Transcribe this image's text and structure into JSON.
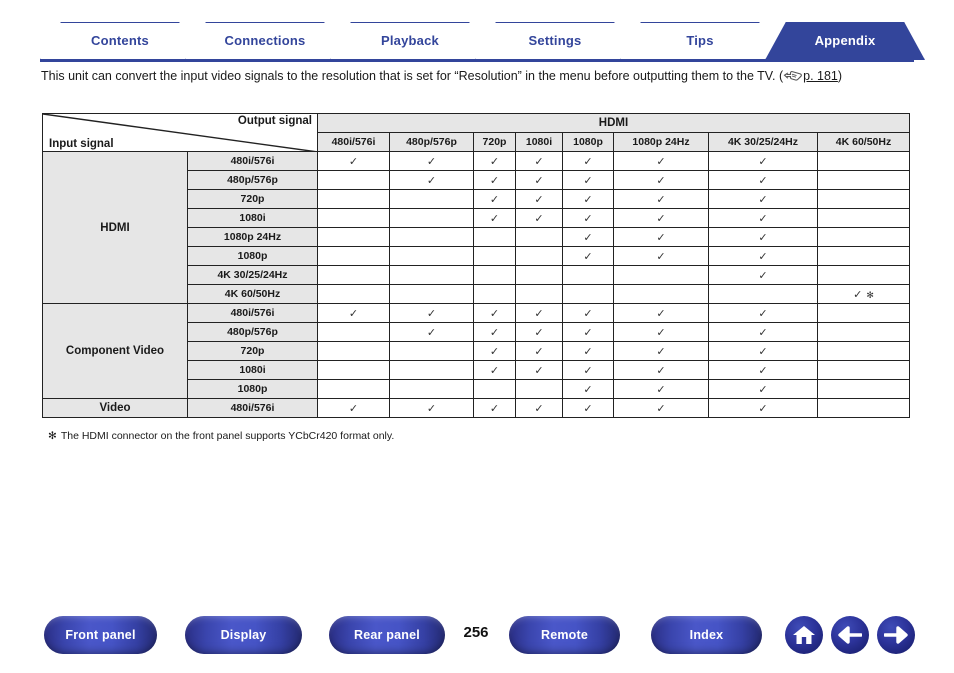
{
  "tabs": [
    {
      "label": "Contents",
      "active": false
    },
    {
      "label": "Connections",
      "active": false
    },
    {
      "label": "Playback",
      "active": false
    },
    {
      "label": "Settings",
      "active": false
    },
    {
      "label": "Tips",
      "active": false
    },
    {
      "label": "Appendix",
      "active": true
    }
  ],
  "intro": {
    "text": "This unit can convert the input video signals to the resolution that is set for “Resolution” in the menu before outputting them to the TV.",
    "ref_open": "(",
    "ref_icon": "pointing-hand-icon",
    "ref_page": "p. 181",
    "ref_close": ")"
  },
  "table": {
    "corner": {
      "output_label": "Output signal",
      "input_label": "Input signal"
    },
    "group_header": "HDMI",
    "columns": [
      "480i/576i",
      "480p/576p",
      "720p",
      "1080i",
      "1080p",
      "1080p 24Hz",
      "4K 30/25/24Hz",
      "4K 60/50Hz"
    ],
    "check_mark": "✓",
    "asterisk_mark": "✻",
    "groups": [
      {
        "name": "HDMI",
        "rows": [
          {
            "label": "480i/576i",
            "cells": [
              "check",
              "check",
              "check",
              "check",
              "check",
              "check",
              "check",
              ""
            ]
          },
          {
            "label": "480p/576p",
            "cells": [
              "",
              "check",
              "check",
              "check",
              "check",
              "check",
              "check",
              ""
            ]
          },
          {
            "label": "720p",
            "cells": [
              "",
              "",
              "check",
              "check",
              "check",
              "check",
              "check",
              ""
            ]
          },
          {
            "label": "1080i",
            "cells": [
              "",
              "",
              "check",
              "check",
              "check",
              "check",
              "check",
              ""
            ]
          },
          {
            "label": "1080p 24Hz",
            "cells": [
              "",
              "",
              "",
              "",
              "check",
              "check",
              "check",
              ""
            ]
          },
          {
            "label": "1080p",
            "cells": [
              "",
              "",
              "",
              "",
              "check",
              "check",
              "check",
              ""
            ]
          },
          {
            "label": "4K 30/25/24Hz",
            "cells": [
              "",
              "",
              "",
              "",
              "",
              "",
              "check",
              ""
            ]
          },
          {
            "label": "4K 60/50Hz",
            "cells": [
              "",
              "",
              "",
              "",
              "",
              "",
              "",
              "check-asterisk"
            ]
          }
        ]
      },
      {
        "name": "Component Video",
        "rows": [
          {
            "label": "480i/576i",
            "cells": [
              "check",
              "check",
              "check",
              "check",
              "check",
              "check",
              "check",
              ""
            ]
          },
          {
            "label": "480p/576p",
            "cells": [
              "",
              "check",
              "check",
              "check",
              "check",
              "check",
              "check",
              ""
            ]
          },
          {
            "label": "720p",
            "cells": [
              "",
              "",
              "check",
              "check",
              "check",
              "check",
              "check",
              ""
            ]
          },
          {
            "label": "1080i",
            "cells": [
              "",
              "",
              "check",
              "check",
              "check",
              "check",
              "check",
              ""
            ]
          },
          {
            "label": "1080p",
            "cells": [
              "",
              "",
              "",
              "",
              "check",
              "check",
              "check",
              ""
            ]
          }
        ]
      },
      {
        "name": "Video",
        "rows": [
          {
            "label": "480i/576i",
            "cells": [
              "check",
              "check",
              "check",
              "check",
              "check",
              "check",
              "check",
              ""
            ]
          }
        ]
      }
    ]
  },
  "footnote": {
    "mark": "✻",
    "text": "The HDMI connector on the front panel supports YCbCr420 format only."
  },
  "bottom_nav": {
    "buttons": [
      {
        "label": "Front panel"
      },
      {
        "label": "Display"
      },
      {
        "label": "Rear panel"
      },
      {
        "label": "Remote"
      },
      {
        "label": "Index"
      }
    ],
    "page_number": "256",
    "icons": [
      {
        "name": "home-icon"
      },
      {
        "name": "back-arrow-icon"
      },
      {
        "name": "forward-arrow-icon"
      }
    ]
  },
  "colors": {
    "brand_blue": "#33459b",
    "table_header_bg": "#e6e6e6",
    "border": "#222222"
  }
}
